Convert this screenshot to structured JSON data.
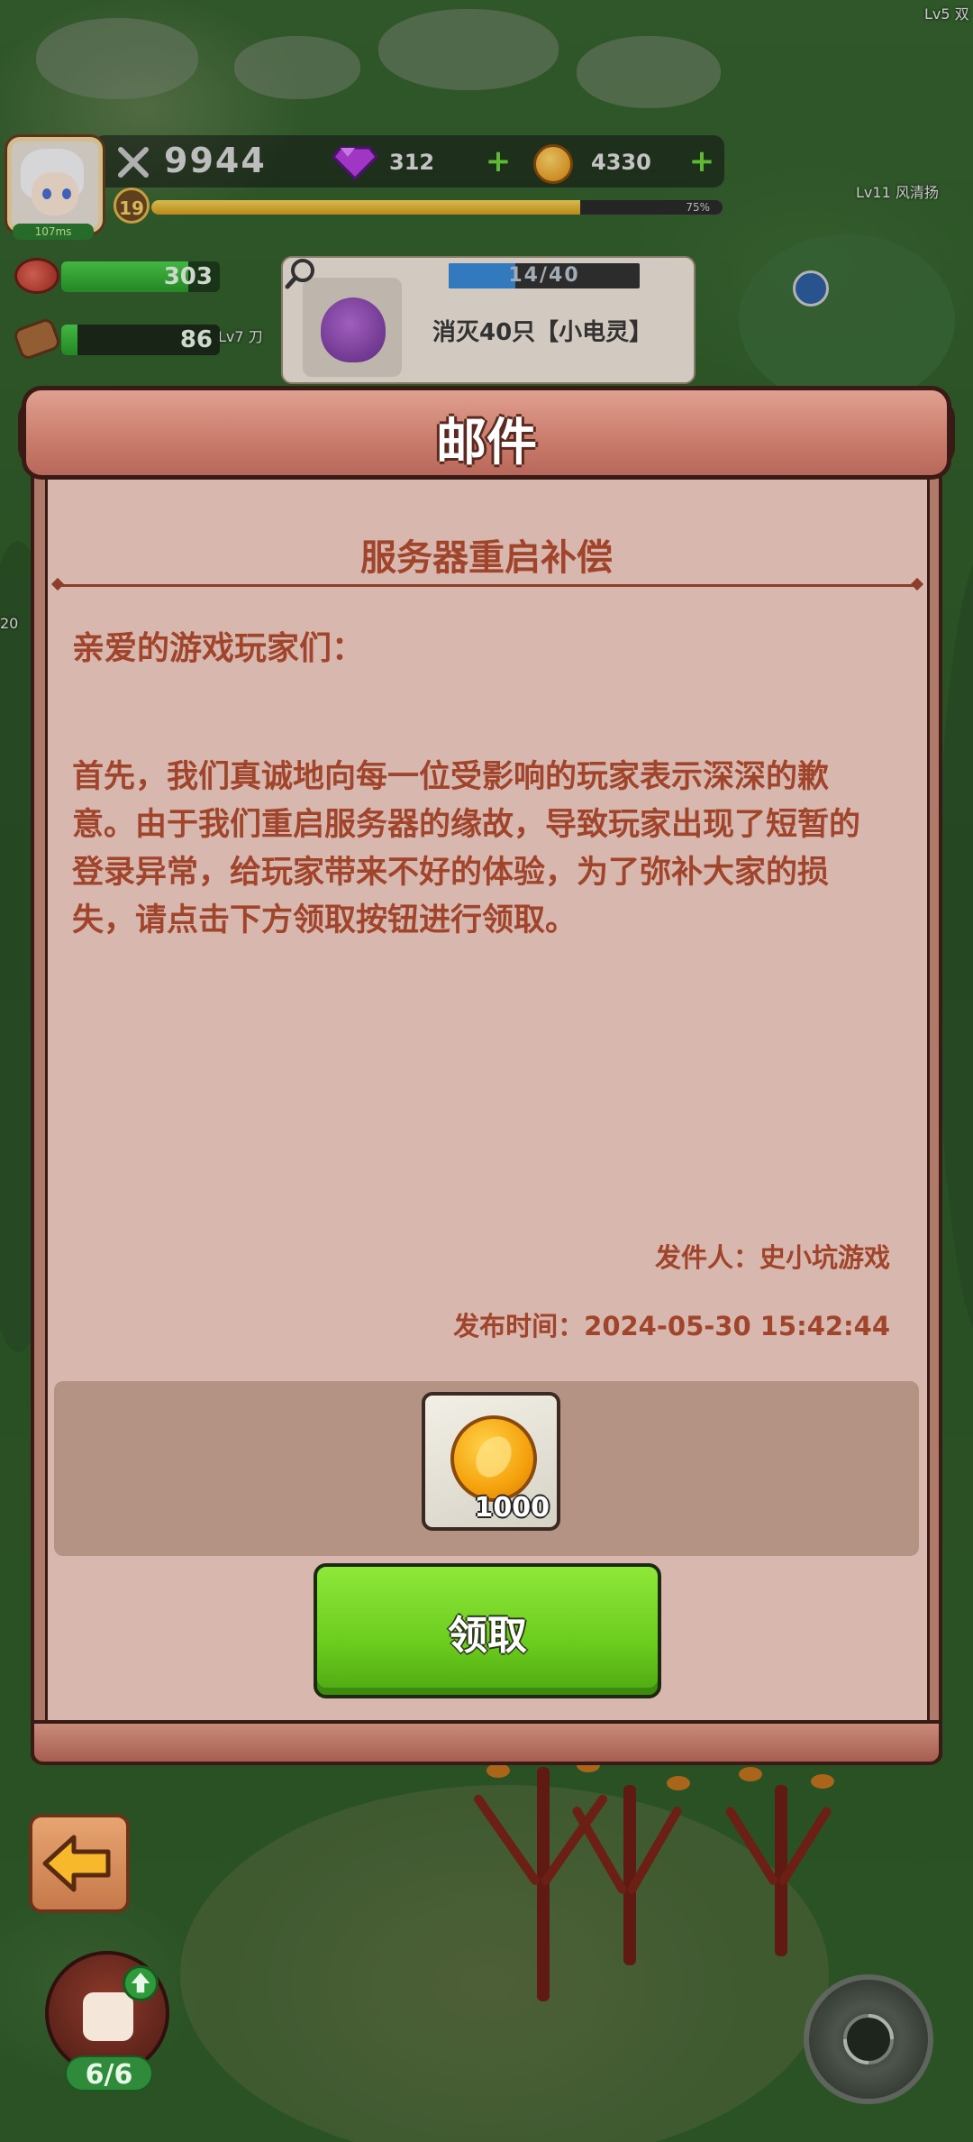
{
  "hud": {
    "ping": "107ms",
    "power": "9944",
    "gems": "312",
    "coins": "4330",
    "level": "19",
    "exp_percent": 75,
    "exp_label": "75%",
    "meat": "303",
    "wood": "86"
  },
  "world_labels": {
    "top_right": "Lv5 双",
    "npc_right": "Lv11 风清扬",
    "npc_left": "Lv7 刀",
    "left_edge": "20"
  },
  "quest": {
    "progress_label": "14/40",
    "progress_current": 14,
    "progress_total": 40,
    "description": "消灭40只【小电灵】"
  },
  "mail": {
    "window_title": "邮件",
    "subject": "服务器重启补偿",
    "greeting": "亲爱的游戏玩家们：",
    "body": "首先，我们真诚地向每一位受影响的玩家表示深深的歉意。由于我们重启服务器的缘故，导致玩家出现了短暂的登录异常，给玩家带来不好的体验，为了弥补大家的损失，请点击下方领取按钮进行领取。",
    "sender": "发件人：史小坑游戏",
    "time": "发布时间：2024-05-30  15:42:44",
    "reward": {
      "icon": "gold-coin-icon",
      "quantity": "1000"
    },
    "claim_label": "领取"
  },
  "bottom": {
    "hero_count": "6/6"
  },
  "colors": {
    "panel": "#d8b8ae",
    "text": "#a0442c",
    "claim_button": "#6ccc1e",
    "banner": "#cc7e6e"
  }
}
